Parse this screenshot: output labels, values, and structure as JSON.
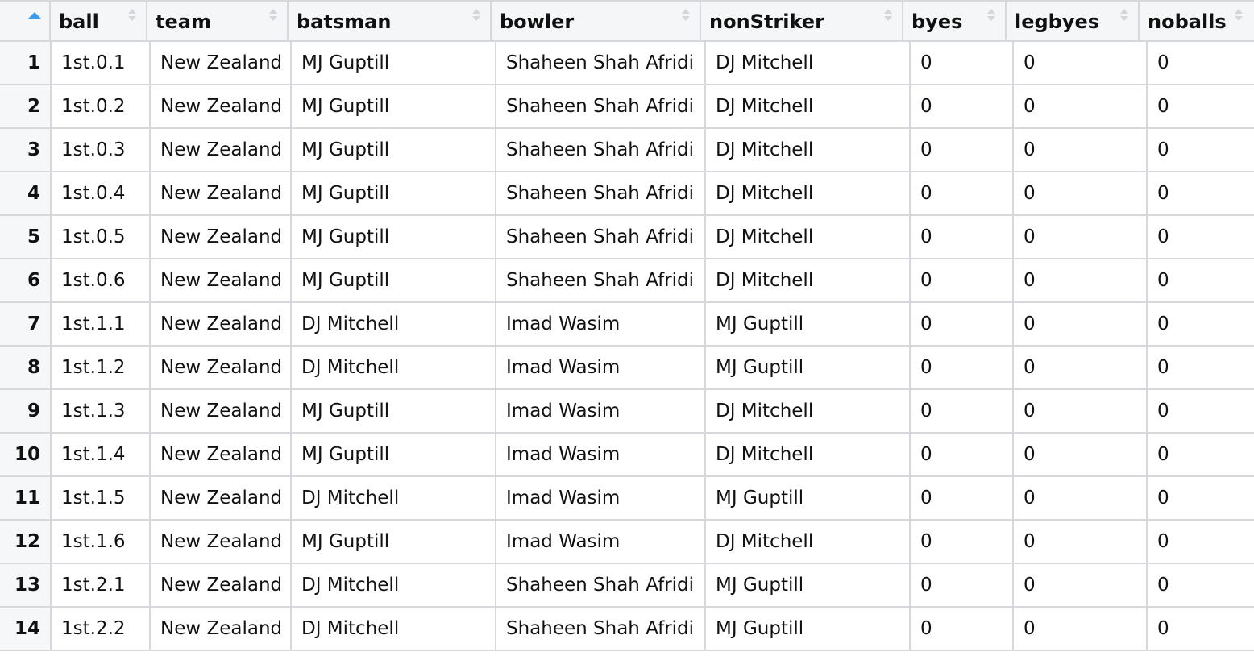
{
  "table": {
    "sort": {
      "column": "row_number",
      "direction": "ascending",
      "indicator_color": "#3d9be9"
    },
    "columns": [
      {
        "key": "ball",
        "label": "ball"
      },
      {
        "key": "team",
        "label": "team"
      },
      {
        "key": "batsman",
        "label": "batsman"
      },
      {
        "key": "bowler",
        "label": "bowler"
      },
      {
        "key": "nonStriker",
        "label": "nonStriker"
      },
      {
        "key": "byes",
        "label": "byes"
      },
      {
        "key": "legbyes",
        "label": "legbyes"
      },
      {
        "key": "noballs",
        "label": "noballs"
      }
    ],
    "rows": [
      {
        "n": "1",
        "ball": "1st.0.1",
        "team": "New Zealand",
        "batsman": "MJ Guptill",
        "bowler": "Shaheen Shah Afridi",
        "nonStriker": "DJ Mitchell",
        "byes": "0",
        "legbyes": "0",
        "noballs": "0"
      },
      {
        "n": "2",
        "ball": "1st.0.2",
        "team": "New Zealand",
        "batsman": "MJ Guptill",
        "bowler": "Shaheen Shah Afridi",
        "nonStriker": "DJ Mitchell",
        "byes": "0",
        "legbyes": "0",
        "noballs": "0"
      },
      {
        "n": "3",
        "ball": "1st.0.3",
        "team": "New Zealand",
        "batsman": "MJ Guptill",
        "bowler": "Shaheen Shah Afridi",
        "nonStriker": "DJ Mitchell",
        "byes": "0",
        "legbyes": "0",
        "noballs": "0"
      },
      {
        "n": "4",
        "ball": "1st.0.4",
        "team": "New Zealand",
        "batsman": "MJ Guptill",
        "bowler": "Shaheen Shah Afridi",
        "nonStriker": "DJ Mitchell",
        "byes": "0",
        "legbyes": "0",
        "noballs": "0"
      },
      {
        "n": "5",
        "ball": "1st.0.5",
        "team": "New Zealand",
        "batsman": "MJ Guptill",
        "bowler": "Shaheen Shah Afridi",
        "nonStriker": "DJ Mitchell",
        "byes": "0",
        "legbyes": "0",
        "noballs": "0"
      },
      {
        "n": "6",
        "ball": "1st.0.6",
        "team": "New Zealand",
        "batsman": "MJ Guptill",
        "bowler": "Shaheen Shah Afridi",
        "nonStriker": "DJ Mitchell",
        "byes": "0",
        "legbyes": "0",
        "noballs": "0"
      },
      {
        "n": "7",
        "ball": "1st.1.1",
        "team": "New Zealand",
        "batsman": "DJ Mitchell",
        "bowler": "Imad Wasim",
        "nonStriker": "MJ Guptill",
        "byes": "0",
        "legbyes": "0",
        "noballs": "0"
      },
      {
        "n": "8",
        "ball": "1st.1.2",
        "team": "New Zealand",
        "batsman": "DJ Mitchell",
        "bowler": "Imad Wasim",
        "nonStriker": "MJ Guptill",
        "byes": "0",
        "legbyes": "0",
        "noballs": "0"
      },
      {
        "n": "9",
        "ball": "1st.1.3",
        "team": "New Zealand",
        "batsman": "MJ Guptill",
        "bowler": "Imad Wasim",
        "nonStriker": "DJ Mitchell",
        "byes": "0",
        "legbyes": "0",
        "noballs": "0"
      },
      {
        "n": "10",
        "ball": "1st.1.4",
        "team": "New Zealand",
        "batsman": "MJ Guptill",
        "bowler": "Imad Wasim",
        "nonStriker": "DJ Mitchell",
        "byes": "0",
        "legbyes": "0",
        "noballs": "0"
      },
      {
        "n": "11",
        "ball": "1st.1.5",
        "team": "New Zealand",
        "batsman": "DJ Mitchell",
        "bowler": "Imad Wasim",
        "nonStriker": "MJ Guptill",
        "byes": "0",
        "legbyes": "0",
        "noballs": "0"
      },
      {
        "n": "12",
        "ball": "1st.1.6",
        "team": "New Zealand",
        "batsman": "MJ Guptill",
        "bowler": "Imad Wasim",
        "nonStriker": "DJ Mitchell",
        "byes": "0",
        "legbyes": "0",
        "noballs": "0"
      },
      {
        "n": "13",
        "ball": "1st.2.1",
        "team": "New Zealand",
        "batsman": "DJ Mitchell",
        "bowler": "Shaheen Shah Afridi",
        "nonStriker": "MJ Guptill",
        "byes": "0",
        "legbyes": "0",
        "noballs": "0"
      },
      {
        "n": "14",
        "ball": "1st.2.2",
        "team": "New Zealand",
        "batsman": "DJ Mitchell",
        "bowler": "Shaheen Shah Afridi",
        "nonStriker": "MJ Guptill",
        "byes": "0",
        "legbyes": "0",
        "noballs": "0"
      }
    ]
  }
}
